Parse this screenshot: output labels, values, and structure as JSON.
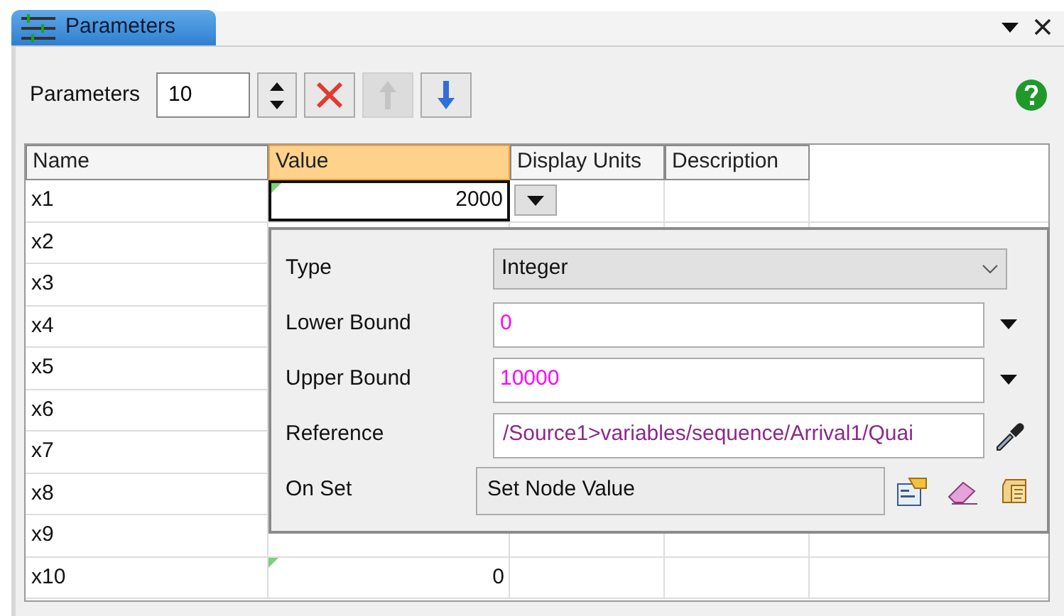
{
  "tab": {
    "title": "Parameters",
    "selected": true
  },
  "toolbar": {
    "label": "Parameters",
    "count": "10",
    "up_disabled": true,
    "down_disabled": false
  },
  "table": {
    "columns": [
      {
        "label": "Name",
        "selected": false
      },
      {
        "label": "Value",
        "selected": true
      },
      {
        "label": "Display Units",
        "selected": false
      },
      {
        "label": "Description",
        "selected": false
      }
    ],
    "rows": [
      {
        "name": "x1",
        "value": "2000",
        "selected": true,
        "marked": true
      },
      {
        "name": "x2"
      },
      {
        "name": "x3"
      },
      {
        "name": "x4"
      },
      {
        "name": "x5"
      },
      {
        "name": "x6"
      },
      {
        "name": "x7"
      },
      {
        "name": "x8"
      },
      {
        "name": "x9"
      },
      {
        "name": "x10",
        "value": "0",
        "selected": false,
        "marked": true
      }
    ]
  },
  "popup": {
    "fields": [
      {
        "kind": "select",
        "label": "Type",
        "value": "Integer"
      },
      {
        "kind": "bound",
        "label": "Lower Bound",
        "value": "0"
      },
      {
        "kind": "bound",
        "label": "Upper Bound",
        "value": "10000"
      },
      {
        "kind": "reference",
        "label": "Reference",
        "value": "/Source1>variables/sequence/Arrival1/Quai"
      },
      {
        "kind": "trigger",
        "label": "On Set",
        "value": "Set Node Value"
      }
    ]
  }
}
